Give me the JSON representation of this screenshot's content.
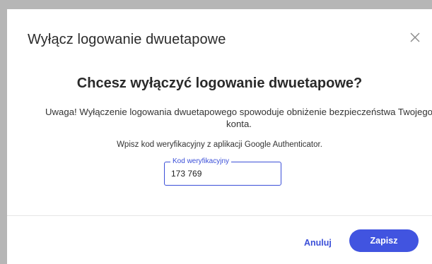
{
  "dialog": {
    "title": "Wyłącz logowanie dwuetapowe",
    "close_icon": "close-icon",
    "headline": "Chcesz wyłączyć logowanie dwuetapowe?",
    "warning": "Uwaga! Wyłączenie logowania dwuetapowego spowoduje obniżenie bezpieczeństwa Twojego konta.",
    "instruction": "Wpisz kod weryfikacyjny z aplikacji Google Authenticator.",
    "code_field": {
      "label": "Kod weryfikacyjny",
      "value": "173 769"
    },
    "cancel_label": "Anuluj",
    "save_label": "Zapisz"
  },
  "colors": {
    "accent": "#4154e0",
    "backdrop": "#b6b6b6",
    "text": "#2a2a2a"
  }
}
